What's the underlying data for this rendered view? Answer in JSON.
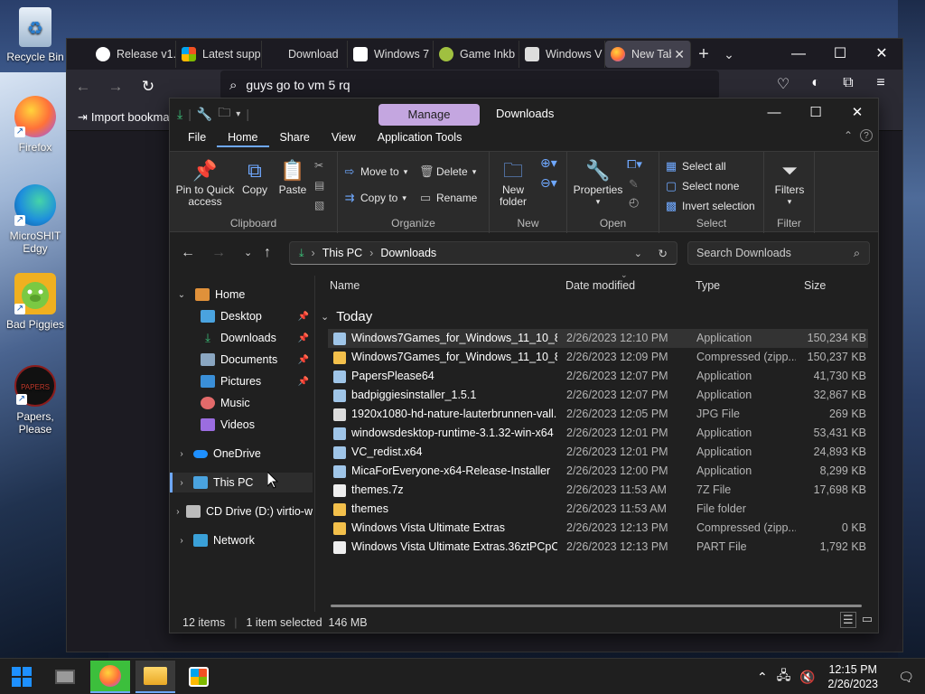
{
  "desktop": {
    "icons": [
      {
        "label": "Recycle Bin"
      },
      {
        "label": "Firefox"
      },
      {
        "label": "MicroSHIT Edgy"
      },
      {
        "label": "Bad Piggies"
      },
      {
        "label": "Papers, Please"
      }
    ]
  },
  "browser": {
    "tabs": [
      {
        "label": "Release v1."
      },
      {
        "label": "Latest supp"
      },
      {
        "label": "Download"
      },
      {
        "label": "Windows 7"
      },
      {
        "label": "Game Inkb"
      },
      {
        "label": "Windows V"
      },
      {
        "label": "New Tab"
      }
    ],
    "url": "guys go to vm 5 rq",
    "bookmark_label": "Import bookma"
  },
  "explorer": {
    "manage_label": "Manage",
    "window_title": "Downloads",
    "menu_tabs": [
      "File",
      "Home",
      "Share",
      "View",
      "Application Tools"
    ],
    "ribbon": {
      "pin_label": "Pin to Quick access",
      "copy_label": "Copy",
      "paste_label": "Paste",
      "clipboard_label": "Clipboard",
      "move_to": "Move to",
      "copy_to": "Copy to",
      "delete": "Delete",
      "rename": "Rename",
      "organize_label": "Organize",
      "new_folder": "New folder",
      "new_label": "New",
      "properties": "Properties",
      "open_label": "Open",
      "select_all": "Select all",
      "select_none": "Select none",
      "invert_selection": "Invert selection",
      "select_label": "Select",
      "filters": "Filters",
      "filter_label": "Filter"
    },
    "address": {
      "segment1": "This PC",
      "segment2": "Downloads"
    },
    "search_placeholder": "Search Downloads",
    "nav": {
      "home": "Home",
      "desktop": "Desktop",
      "downloads": "Downloads",
      "documents": "Documents",
      "pictures": "Pictures",
      "music": "Music",
      "videos": "Videos",
      "onedrive": "OneDrive",
      "thispc": "This PC",
      "cddrive": "CD Drive (D:) virtio-w",
      "network": "Network"
    },
    "columns": {
      "name": "Name",
      "date": "Date modified",
      "type": "Type",
      "size": "Size"
    },
    "group": "Today",
    "files": [
      {
        "name": "Windows7Games_for_Windows_11_10_8",
        "date": "2/26/2023 12:10 PM",
        "type": "Application",
        "size": "150,234 KB"
      },
      {
        "name": "Windows7Games_for_Windows_11_10_8",
        "date": "2/26/2023 12:09 PM",
        "type": "Compressed (zipp...",
        "size": "150,237 KB"
      },
      {
        "name": "PapersPlease64",
        "date": "2/26/2023 12:07 PM",
        "type": "Application",
        "size": "41,730 KB"
      },
      {
        "name": "badpiggiesinstaller_1.5.1",
        "date": "2/26/2023 12:07 PM",
        "type": "Application",
        "size": "32,867 KB"
      },
      {
        "name": "1920x1080-hd-nature-lauterbrunnen-vall...",
        "date": "2/26/2023 12:05 PM",
        "type": "JPG File",
        "size": "269 KB"
      },
      {
        "name": "windowsdesktop-runtime-3.1.32-win-x64",
        "date": "2/26/2023 12:01 PM",
        "type": "Application",
        "size": "53,431 KB"
      },
      {
        "name": "VC_redist.x64",
        "date": "2/26/2023 12:01 PM",
        "type": "Application",
        "size": "24,893 KB"
      },
      {
        "name": "MicaForEveryone-x64-Release-Installer",
        "date": "2/26/2023 12:00 PM",
        "type": "Application",
        "size": "8,299 KB"
      },
      {
        "name": "themes.7z",
        "date": "2/26/2023 11:53 AM",
        "type": "7Z File",
        "size": "17,698 KB"
      },
      {
        "name": "themes",
        "date": "2/26/2023 11:53 AM",
        "type": "File folder",
        "size": ""
      },
      {
        "name": "Windows Vista Ultimate Extras",
        "date": "2/26/2023 12:13 PM",
        "type": "Compressed (zipp...",
        "size": "0 KB"
      },
      {
        "name": "Windows Vista Ultimate Extras.36ztPCpC....",
        "date": "2/26/2023 12:13 PM",
        "type": "PART File",
        "size": "1,792 KB"
      }
    ],
    "status": {
      "count": "12 items",
      "selected": "1 item selected  146 MB"
    }
  },
  "taskbar": {
    "time": "12:15 PM",
    "date": "2/26/2023"
  },
  "colors": {
    "accent": "#6ea8ff",
    "manage": "#c4a6e0"
  }
}
